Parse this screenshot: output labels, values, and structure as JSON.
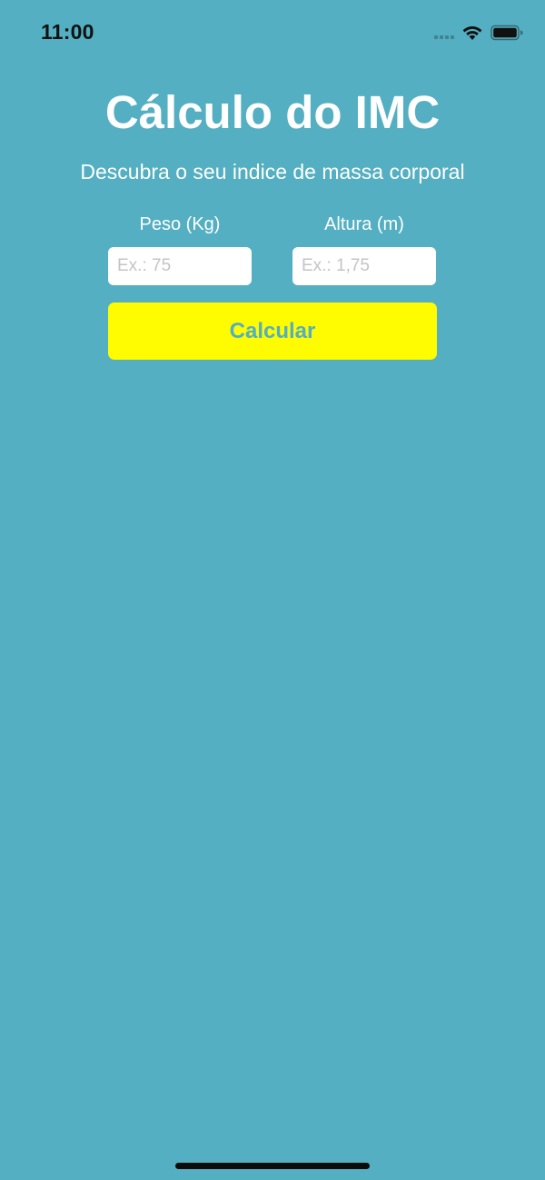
{
  "status_bar": {
    "time": "11:00",
    "icons": [
      "signal-icon",
      "wifi-icon",
      "battery-icon"
    ]
  },
  "header": {
    "title": "Cálculo do IMC",
    "subtitle": "Descubra o seu indice de massa corporal"
  },
  "form": {
    "weight": {
      "label": "Peso (Kg)",
      "value": "",
      "placeholder": "Ex.: 75"
    },
    "height": {
      "label": "Altura (m)",
      "value": "",
      "placeholder": "Ex.: 1,75"
    },
    "submit_label": "Calcular"
  },
  "colors": {
    "background": "#53afc1",
    "button_background": "#fffb00",
    "button_text": "#53afc1",
    "text": "#ffffff"
  }
}
